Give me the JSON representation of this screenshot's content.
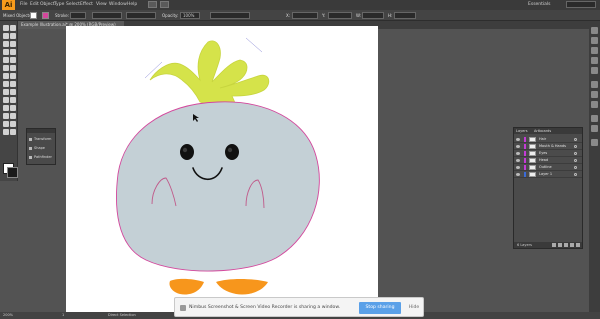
{
  "menubar": {
    "logo": "Ai",
    "items": [
      "File",
      "Edit",
      "Object",
      "Type",
      "Select",
      "Effect",
      "View",
      "Window",
      "Help"
    ],
    "workspace": "Essentials"
  },
  "controlbar": {
    "selection_label": "Mixed Objects",
    "stroke_label": "Stroke:",
    "opacity_label": "Opacity:",
    "opacity_value": "100%",
    "x_label": "X:",
    "y_label": "Y:",
    "w_label": "W:",
    "h_label": "H:"
  },
  "document": {
    "tab_label": "Example Illustration.ai* @ 200% (RGB/Preview)"
  },
  "properties_panel": {
    "items": [
      "Transform",
      "Shape",
      "Pathfinder"
    ]
  },
  "layers_panel": {
    "tabs": [
      "Layers",
      "Artboards"
    ],
    "layers": [
      {
        "name": "Hair",
        "color": "#c43bd6"
      },
      {
        "name": "Mouth & Hands",
        "color": "#c43bd6"
      },
      {
        "name": "Eyes",
        "color": "#c43bd6"
      },
      {
        "name": "Head",
        "color": "#c43bd6"
      },
      {
        "name": "Outline",
        "color": "#c43bd6"
      },
      {
        "name": "Layer 1",
        "color": "#3b6bd6"
      }
    ],
    "count": "6 Layers"
  },
  "statusbar": {
    "zoom": "200%",
    "page": "1",
    "tool": "Direct Selection"
  },
  "share_bar": {
    "message": "Nimbus Screenshot & Screen Video Recorder is sharing a window.",
    "stop_label": "Stop sharing",
    "hide_label": "Hide"
  },
  "colors": {
    "body": "#c4d0d6",
    "hair": "#d5e34a",
    "feet": "#f7961c",
    "outline": "#d3479c"
  }
}
